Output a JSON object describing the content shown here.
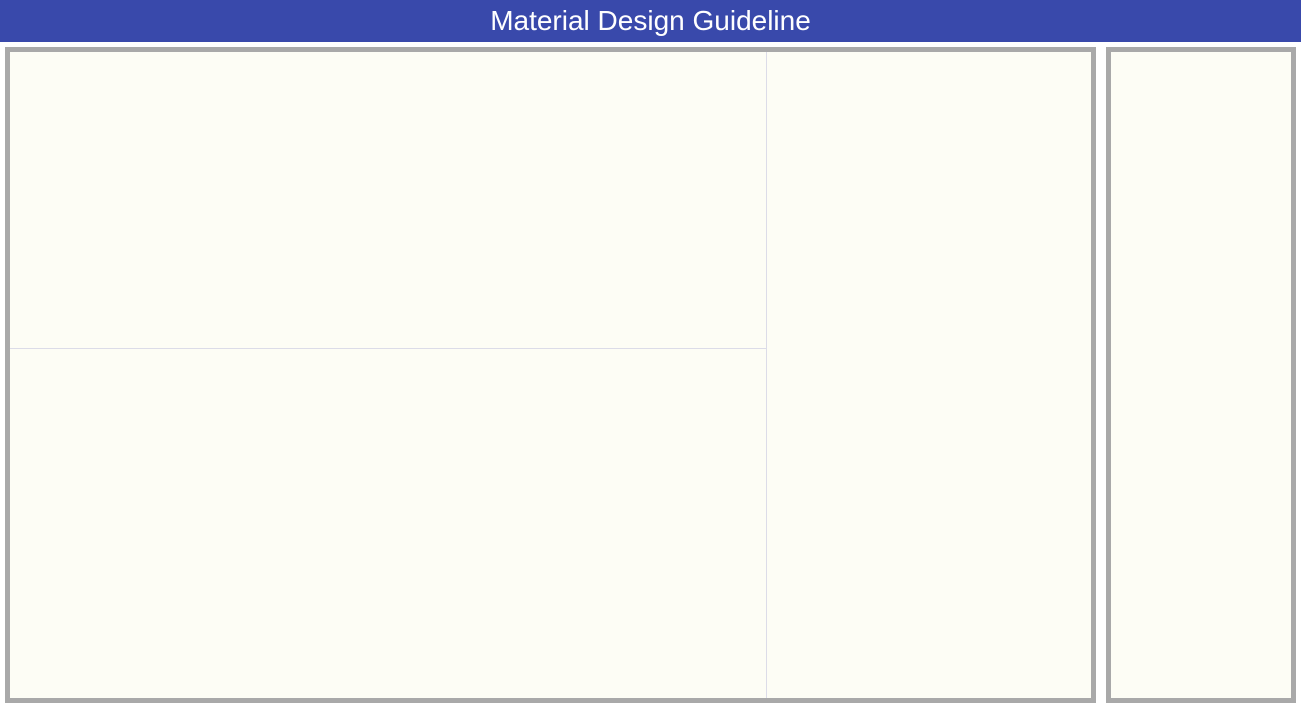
{
  "header": {
    "title": "Material Design Guideline"
  },
  "colors": {
    "header_bg": "#3949ab",
    "header_text": "#ffffff",
    "panel_border": "#a9a9a9",
    "panel_bg": "#fdfdf5",
    "divider": "#dcdce8"
  }
}
